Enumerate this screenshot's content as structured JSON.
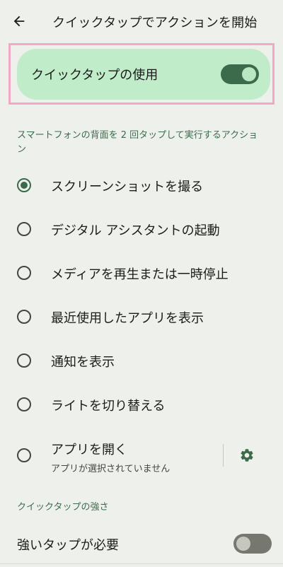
{
  "app_bar": {
    "title": "クイックタップでアクションを開始",
    "back_icon": "arrow-back-icon"
  },
  "main_toggle": {
    "label": "クイックタップの使用",
    "checked": true
  },
  "actions_section": {
    "header": "スマートフォンの背面を 2 回タップして実行するアクション",
    "options": [
      {
        "label": "スクリーンショットを撮る",
        "selected": true
      },
      {
        "label": "デジタル アシスタントの起動",
        "selected": false
      },
      {
        "label": "メディアを再生または一時停止",
        "selected": false
      },
      {
        "label": "最近使用したアプリを表示",
        "selected": false
      },
      {
        "label": "通知を表示",
        "selected": false
      },
      {
        "label": "ライトを切り替える",
        "selected": false
      }
    ],
    "open_app": {
      "label": "アプリを開く",
      "subtitle": "アプリが選択されていません",
      "selected": false,
      "settings_icon": "gear-icon"
    }
  },
  "strength_section": {
    "header": "クイックタップの強さ",
    "toggle_label": "強いタップが必要",
    "checked": false
  },
  "colors": {
    "background": "#eef0eb",
    "accent": "#3c6b4c",
    "card": "#c0ecca",
    "highlight": "#f2a9c6"
  }
}
